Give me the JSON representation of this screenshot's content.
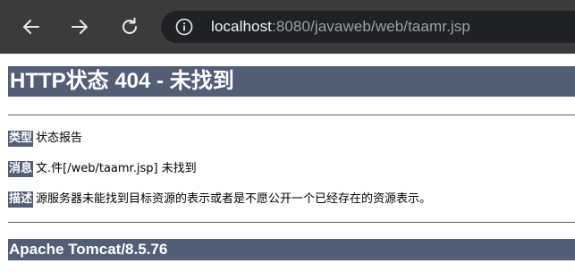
{
  "browser": {
    "back_icon": "arrow-left-icon",
    "forward_icon": "arrow-right-icon",
    "reload_icon": "reload-icon",
    "site_info_icon": "info-icon",
    "url_host": "localhost",
    "url_rest": ":8080/javaweb/web/taamr.jsp"
  },
  "page": {
    "title": "HTTP状态 404 - 未找到",
    "type_label": "类型",
    "type_value": "状态报告",
    "message_label": "消息",
    "message_value": "文.件[/web/taamr.jsp] 未找到",
    "description_label": "描述",
    "description_value": "源服务器未能找到目标资源的表示或者是不愿公开一个已经存在的资源表示。",
    "footer": "Apache Tomcat/8.5.76"
  },
  "colors": {
    "toolbar_bg": "#3b3b3b",
    "address_bg": "#202124",
    "tomcat_header_bg": "#525d76"
  }
}
